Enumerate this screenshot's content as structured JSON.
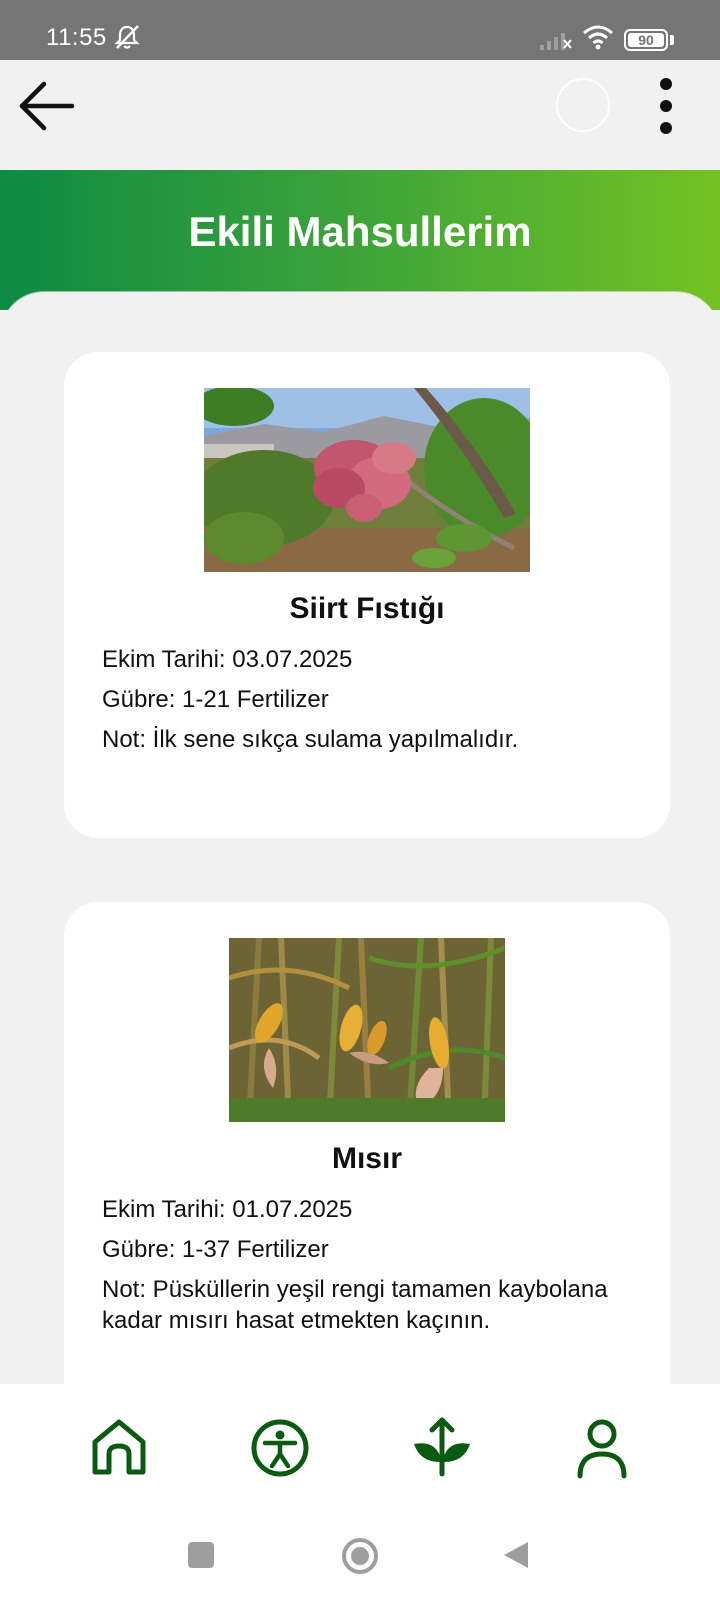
{
  "status_bar": {
    "time": "11:55",
    "battery_level": "90",
    "icons": [
      "bell-off-icon",
      "signal-icon",
      "wifi-icon",
      "battery-icon"
    ]
  },
  "app_bar": {
    "icons": [
      "back-arrow-icon",
      "loading-circle-icon",
      "more-vert-icon"
    ]
  },
  "header": {
    "title": "Ekili Mahsullerim"
  },
  "crops": [
    {
      "name": "Siirt Fıstığı",
      "image_icon": "pistachio-tree-photo",
      "planting_date": "Ekim Tarihi: 03.07.2025",
      "fertilizer": "Gübre: 1-21 Fertilizer",
      "note": "Not: İlk sene sıkça sulama yapılmalıdır."
    },
    {
      "name": "Mısır",
      "image_icon": "corn-field-photo",
      "planting_date": "Ekim Tarihi: 01.07.2025",
      "fertilizer": "Gübre: 1-37 Fertilizer",
      "note": "Not: Püsküllerin yeşil rengi tamamen kaybolana kadar mısırı hasat etmekten kaçının."
    }
  ],
  "bottom_nav": {
    "icons": [
      "home-icon",
      "accessibility-icon",
      "plant-upload-icon",
      "profile-icon"
    ]
  },
  "colors": {
    "primary_green": "#0e8a44",
    "accent_green": "#74c224",
    "icon_green": "#0b5a12"
  }
}
